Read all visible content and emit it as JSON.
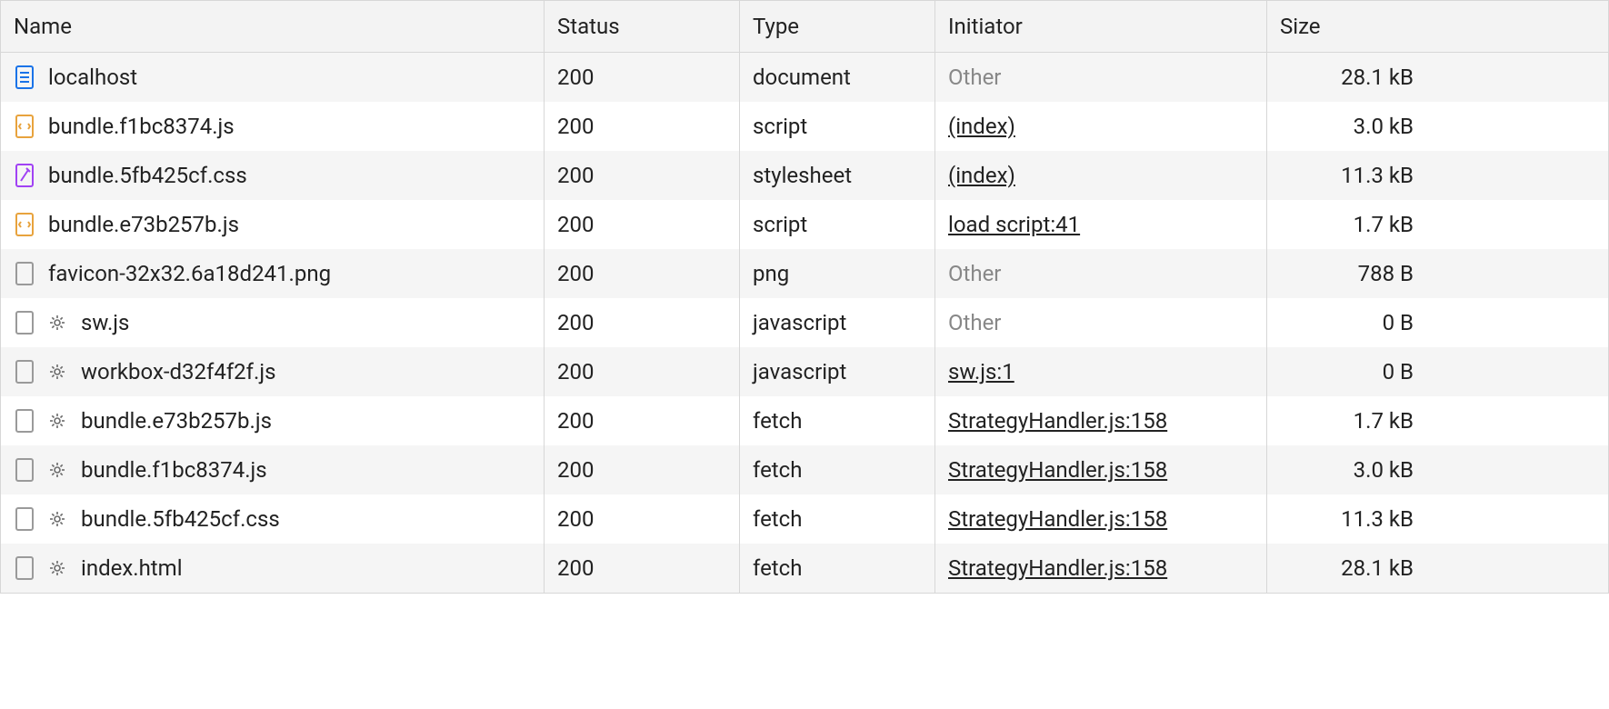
{
  "columns": {
    "name": "Name",
    "status": "Status",
    "type": "Type",
    "initiator": "Initiator",
    "size": "Size"
  },
  "rows": [
    {
      "icon": "document",
      "gear": false,
      "name": "localhost",
      "status": "200",
      "type": "document",
      "initiator": "Other",
      "initiator_link": false,
      "size": "28.1 kB"
    },
    {
      "icon": "script",
      "gear": false,
      "name": "bundle.f1bc8374.js",
      "status": "200",
      "type": "script",
      "initiator": "(index)",
      "initiator_link": true,
      "size": "3.0 kB"
    },
    {
      "icon": "stylesheet",
      "gear": false,
      "name": "bundle.5fb425cf.css",
      "status": "200",
      "type": "stylesheet",
      "initiator": "(index)",
      "initiator_link": true,
      "size": "11.3 kB"
    },
    {
      "icon": "script",
      "gear": false,
      "name": "bundle.e73b257b.js",
      "status": "200",
      "type": "script",
      "initiator": "load script:41",
      "initiator_link": true,
      "size": "1.7 kB"
    },
    {
      "icon": "generic",
      "gear": false,
      "name": "favicon-32x32.6a18d241.png",
      "status": "200",
      "type": "png",
      "initiator": "Other",
      "initiator_link": false,
      "size": "788 B"
    },
    {
      "icon": "generic",
      "gear": true,
      "name": "sw.js",
      "status": "200",
      "type": "javascript",
      "initiator": "Other",
      "initiator_link": false,
      "size": "0 B"
    },
    {
      "icon": "generic",
      "gear": true,
      "name": "workbox-d32f4f2f.js",
      "status": "200",
      "type": "javascript",
      "initiator": "sw.js:1",
      "initiator_link": true,
      "size": "0 B"
    },
    {
      "icon": "generic",
      "gear": true,
      "name": "bundle.e73b257b.js",
      "status": "200",
      "type": "fetch",
      "initiator": "StrategyHandler.js:158",
      "initiator_link": true,
      "size": "1.7 kB"
    },
    {
      "icon": "generic",
      "gear": true,
      "name": "bundle.f1bc8374.js",
      "status": "200",
      "type": "fetch",
      "initiator": "StrategyHandler.js:158",
      "initiator_link": true,
      "size": "3.0 kB"
    },
    {
      "icon": "generic",
      "gear": true,
      "name": "bundle.5fb425cf.css",
      "status": "200",
      "type": "fetch",
      "initiator": "StrategyHandler.js:158",
      "initiator_link": true,
      "size": "11.3 kB"
    },
    {
      "icon": "generic",
      "gear": true,
      "name": "index.html",
      "status": "200",
      "type": "fetch",
      "initiator": "StrategyHandler.js:158",
      "initiator_link": true,
      "size": "28.1 kB"
    }
  ]
}
